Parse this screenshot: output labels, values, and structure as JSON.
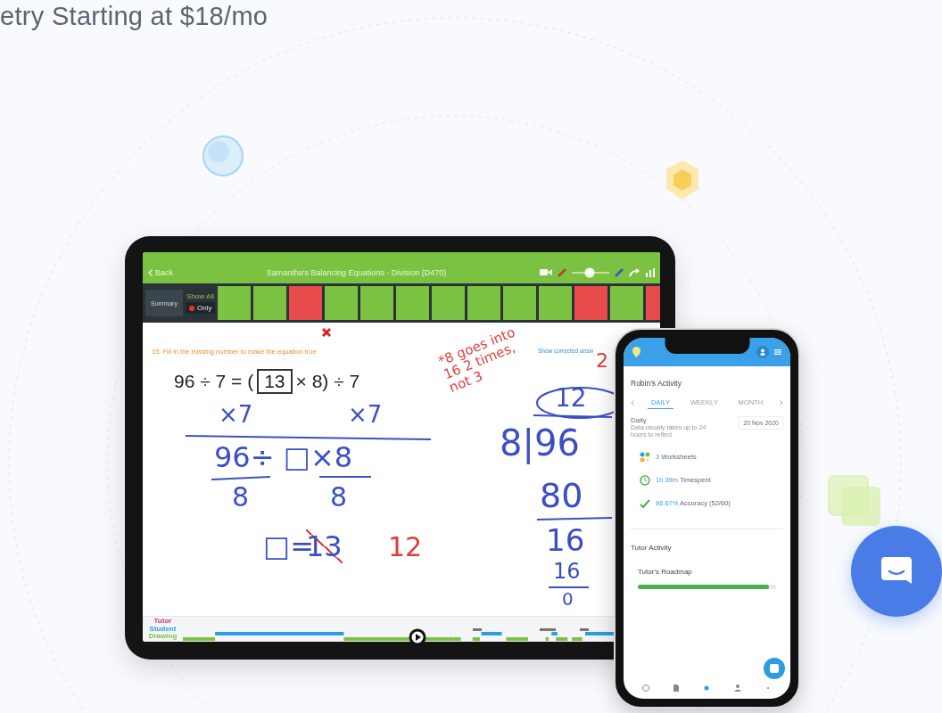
{
  "heading": "etry Starting at $18/mo",
  "tablet": {
    "nav": {
      "back": "Back",
      "title": "Samantha's Balancing Equations - Division (D470)"
    },
    "grade_bar": {
      "summary": "Summary",
      "show_all": "Show All",
      "only": "Only",
      "tiles": [
        {
          "correct": true
        },
        {
          "correct": true
        },
        {
          "correct": false
        },
        {
          "correct": true
        },
        {
          "correct": true
        },
        {
          "correct": true
        },
        {
          "correct": true
        },
        {
          "correct": true
        },
        {
          "correct": true
        },
        {
          "correct": true
        },
        {
          "correct": false
        },
        {
          "correct": true
        },
        {
          "correct": false
        }
      ]
    },
    "question": "15. Fill in the missing number to make the equation true",
    "show_answer_link": "Show corrected answ",
    "equation": {
      "left": "96 ÷ 7 = (",
      "answer": "13",
      "right": "× 8) ÷ 7"
    },
    "handwriting": [
      {
        "text": "×7",
        "color": "#3b4fc4",
        "struck": false
      },
      {
        "text": "×7",
        "color": "#3b4fc4",
        "struck": false
      },
      {
        "text": "96÷ □×8",
        "color": "#3b4fc4",
        "struck": false
      },
      {
        "text": "8",
        "color": "#3b4fc4",
        "struck": false
      },
      {
        "text": "8",
        "color": "#3b4fc4",
        "struck": false
      },
      {
        "text": "□=",
        "color": "#3b4fc4",
        "struck": false
      },
      {
        "text": "13",
        "color": "#3b4fc4",
        "struck": true
      },
      {
        "text": "12",
        "color": "#e33b3b",
        "struck": false
      },
      {
        "text": "*8 goes into 16 2 times, not 3",
        "color": "#e33b3b",
        "struck": false
      },
      {
        "text": "2",
        "color": "#e33b3b",
        "struck": false
      },
      {
        "text": "12",
        "color": "#3b4fc4",
        "struck": false
      },
      {
        "text": "8|96",
        "color": "#3b4fc4",
        "struck": false
      },
      {
        "text": "80",
        "color": "#3b4fc4",
        "struck": false
      },
      {
        "text": "16",
        "color": "#3b4fc4",
        "struck": false
      },
      {
        "text": "16",
        "color": "#3b4fc4",
        "struck": false
      },
      {
        "text": "0",
        "color": "#3b4fc4",
        "struck": false
      }
    ],
    "timeline_legend": [
      {
        "label": "Tutor",
        "color": "#d6336c"
      },
      {
        "label": "Student",
        "color": "#2f9be0"
      },
      {
        "label": "Drawing",
        "color": "#7cc242"
      }
    ]
  },
  "phone": {
    "title": "Robin's Activity",
    "tabs": [
      {
        "label": "DAILY",
        "selected": true
      },
      {
        "label": "WEEKLY",
        "selected": false
      },
      {
        "label": "MONTH",
        "selected": false
      }
    ],
    "period": "Daily",
    "note": "Data usually takes up to 24 hours to reflect",
    "date": "20 Nov 2020",
    "stats": [
      {
        "kind": "worksheets",
        "value": "3",
        "label": "Worksheets"
      },
      {
        "kind": "time",
        "value": "1h 39m",
        "label": "Timespent"
      },
      {
        "kind": "accuracy",
        "value": "86.67%",
        "label": "Accuracy (52/60)"
      }
    ],
    "tutor_section": "Tutor Activity",
    "roadmap": {
      "label": "Tutor's Roadmap",
      "level": 0.95
    },
    "bottom_nav": [
      {
        "kind": "home",
        "selected": false
      },
      {
        "kind": "file",
        "selected": false
      },
      {
        "kind": "dot",
        "selected": true
      },
      {
        "kind": "person",
        "selected": false
      },
      {
        "kind": "more",
        "selected": false
      }
    ]
  }
}
